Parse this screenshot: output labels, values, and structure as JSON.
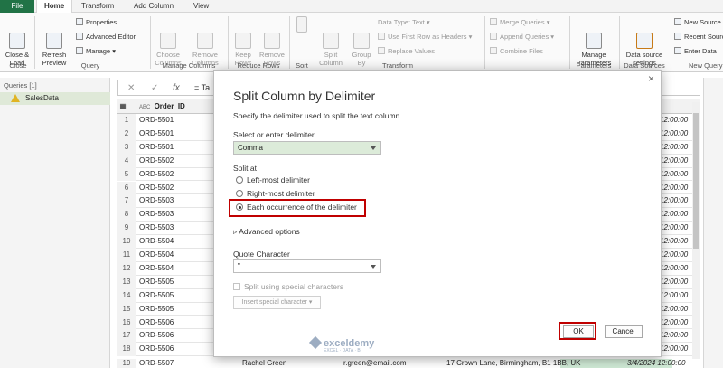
{
  "ribbon": {
    "tabs": [
      "File",
      "Home",
      "Transform",
      "Add Column",
      "View"
    ],
    "groups": {
      "close": {
        "label": "Close",
        "close_load": "Close &\nLoad"
      },
      "query": {
        "label": "Query",
        "refresh_preview": "Refresh\nPreview",
        "properties": "Properties",
        "advanced_editor": "Advanced Editor",
        "manage": "Manage"
      },
      "manage_columns": {
        "label": "Manage Columns",
        "choose_columns": "Choose\nColumns",
        "remove_columns": "Remove\nColumns"
      },
      "reduce_rows": {
        "label": "Reduce Rows",
        "keep_rows": "Keep\nRows",
        "remove_rows": "Remove\nRows"
      },
      "sort": {
        "label": "Sort"
      },
      "transform": {
        "label": "Transform",
        "split_column": "Split\nColumn",
        "group_by": "Group\nBy",
        "data_type": "Data Type: Text",
        "first_row_headers": "Use First Row as Headers",
        "replace_values": "Replace Values"
      },
      "combine": {
        "merge_queries": "Merge Queries",
        "append_queries": "Append Queries",
        "combine_files": "Combine Files"
      },
      "parameters": {
        "label": "Parameters",
        "manage_parameters": "Manage\nParameters"
      },
      "data_sources": {
        "label": "Data Sources",
        "data_source_settings": "Data source\nsettings"
      },
      "new_query": {
        "label": "New Query",
        "new_source": "New Source",
        "recent_sources": "Recent Sources",
        "enter_data": "Enter Data"
      }
    }
  },
  "queries_pane": {
    "header": "Queries [1]",
    "items": [
      "SalesData"
    ]
  },
  "formula_bar": {
    "fx": "fx",
    "text": "= Ta"
  },
  "grid": {
    "column_header": "Order_ID",
    "type_badge": "ABC",
    "rows": [
      {
        "n": "1",
        "id": "ORD-5501",
        "time": "12:00:00"
      },
      {
        "n": "2",
        "id": "ORD-5501",
        "time": "12:00:00"
      },
      {
        "n": "3",
        "id": "ORD-5501",
        "time": "12:00:00"
      },
      {
        "n": "4",
        "id": "ORD-5502",
        "time": "12:00:00"
      },
      {
        "n": "5",
        "id": "ORD-5502",
        "time": "12:00:00"
      },
      {
        "n": "6",
        "id": "ORD-5502",
        "time": "12:00:00"
      },
      {
        "n": "7",
        "id": "ORD-5503",
        "time": "12:00:00"
      },
      {
        "n": "8",
        "id": "ORD-5503",
        "time": "12:00:00"
      },
      {
        "n": "9",
        "id": "ORD-5503",
        "time": "12:00:00"
      },
      {
        "n": "10",
        "id": "ORD-5504",
        "time": "12:00:00"
      },
      {
        "n": "11",
        "id": "ORD-5504",
        "time": "12:00:00"
      },
      {
        "n": "12",
        "id": "ORD-5504",
        "time": "12:00:00"
      },
      {
        "n": "13",
        "id": "ORD-5505",
        "time": "12:00:00"
      },
      {
        "n": "14",
        "id": "ORD-5505",
        "time": "12:00:00"
      },
      {
        "n": "15",
        "id": "ORD-5505",
        "time": "12:00:00"
      },
      {
        "n": "16",
        "id": "ORD-5506",
        "time": "12:00:00"
      },
      {
        "n": "17",
        "id": "ORD-5506",
        "time": "12:00:00"
      },
      {
        "n": "18",
        "id": "ORD-5506",
        "time": "12:00:00"
      }
    ],
    "last_row": {
      "n": "19",
      "id": "ORD-5507",
      "name": "Rachel Green",
      "email": "r.green@email.com",
      "address": "17 Crown Lane, Birmingham, B1 1BB, UK",
      "date": "3/4/2024 12:00:00"
    }
  },
  "dialog": {
    "title": "Split Column by Delimiter",
    "subtitle": "Specify the delimiter used to split the text column.",
    "delimiter_label": "Select or enter delimiter",
    "delimiter_value": "Comma",
    "split_at_label": "Split at",
    "options": [
      "Left-most delimiter",
      "Right-most delimiter",
      "Each occurrence of the delimiter"
    ],
    "selected_option": 2,
    "advanced": "Advanced options",
    "quote_label": "Quote Character",
    "quote_value": "\"",
    "special_chars": "Split using special characters",
    "insert_special": "Insert special character",
    "ok": "OK",
    "cancel": "Cancel",
    "close": "×"
  },
  "watermark": {
    "name": "exceldemy",
    "tagline": "EXCEL · DATA · BI"
  },
  "colors": {
    "file_tab": "#217346",
    "highlight": "#c00000",
    "selected_query": "#dfe9d8"
  }
}
